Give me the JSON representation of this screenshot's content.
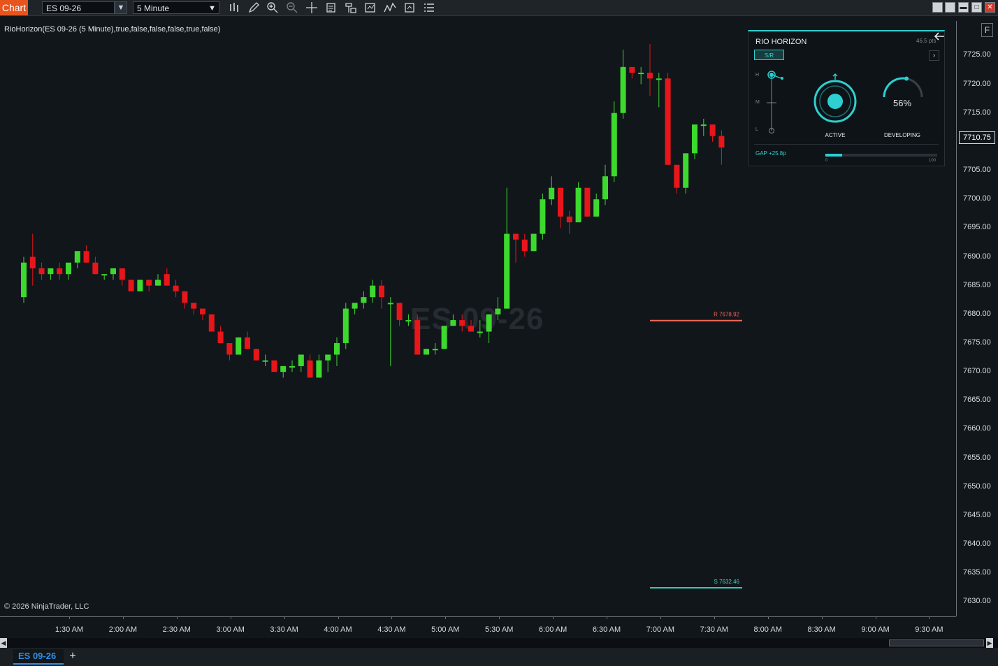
{
  "toolbar": {
    "chart_tab": "Chart",
    "instrument": "ES 09-26",
    "interval": "5 Minute",
    "icons": [
      "bars-type-icon",
      "pencil-icon",
      "zoom-in-icon",
      "zoom-out-icon",
      "crosshair-icon",
      "data-box-icon",
      "properties-icon",
      "strategies-icon",
      "indicators-icon",
      "templates-icon",
      "list-icon"
    ]
  },
  "window_buttons": [
    "tile-icon",
    "tile-icon",
    "minimize-icon",
    "maximize-icon",
    "close-icon"
  ],
  "chart": {
    "indicator_label": "RioHorizon(ES 09-26 (5 Minute),true,false,false,false,true,false)",
    "watermark": "ES 09-26",
    "copyright": "© 2026 NinjaTrader, LLC",
    "f_button": "F",
    "last_price": "7710.75",
    "up_color": "#3dd92e",
    "down_color": "#e8161a",
    "resistance_label": "R 7678.92",
    "resistance_value": 7678.92,
    "support_label": "S 7632.46",
    "support_value": 7632.46
  },
  "chart_data": {
    "type": "candlestick",
    "price_ticks": [
      "7725.00",
      "7720.00",
      "7715.00",
      "7710.00",
      "7705.00",
      "7700.00",
      "7695.00",
      "7690.00",
      "7685.00",
      "7680.00",
      "7675.00",
      "7670.00",
      "7665.00",
      "7660.00",
      "7655.00",
      "7650.00",
      "7645.00",
      "7640.00",
      "7635.00",
      "7630.00"
    ],
    "time_ticks": [
      "1:30 AM",
      "2:00 AM",
      "2:30 AM",
      "3:00 AM",
      "3:30 AM",
      "4:00 AM",
      "4:30 AM",
      "5:00 AM",
      "5:30 AM",
      "6:00 AM",
      "6:30 AM",
      "7:00 AM",
      "7:30 AM",
      "8:00 AM",
      "8:30 AM",
      "9:00 AM",
      "9:30 AM"
    ],
    "ylim": [
      7627.5,
      7731.0
    ],
    "candles": [
      [
        7683,
        7690,
        7682,
        7689
      ],
      [
        7690,
        7694,
        7685,
        7688
      ],
      [
        7688,
        7689,
        7686,
        7687
      ],
      [
        7687,
        7688,
        7686,
        7688
      ],
      [
        7688,
        7689,
        7686,
        7687
      ],
      [
        7687,
        7688,
        7686,
        7689
      ],
      [
        7689,
        7691,
        7688,
        7691
      ],
      [
        7691,
        7692,
        7689,
        7689
      ],
      [
        7689,
        7690,
        7687,
        7687
      ],
      [
        7687,
        7687,
        7686,
        7687
      ],
      [
        7687,
        7688,
        7686,
        7688
      ],
      [
        7688,
        7688,
        7685,
        7686
      ],
      [
        7686,
        7686,
        7684,
        7684
      ],
      [
        7684,
        7686,
        7684,
        7686
      ],
      [
        7686,
        7686,
        7684,
        7685
      ],
      [
        7685,
        7687,
        7685,
        7686
      ],
      [
        7687,
        7688,
        7685,
        7685
      ],
      [
        7685,
        7686,
        7683,
        7684
      ],
      [
        7684,
        7684,
        7681,
        7682
      ],
      [
        7682,
        7682,
        7680,
        7681
      ],
      [
        7681,
        7681,
        7679,
        7680
      ],
      [
        7680,
        7680,
        7677,
        7677
      ],
      [
        7677,
        7678,
        7675,
        7675
      ],
      [
        7675,
        7675,
        7672,
        7673
      ],
      [
        7673,
        7676,
        7673,
        7676
      ],
      [
        7676,
        7677,
        7674,
        7674
      ],
      [
        7674,
        7674,
        7672,
        7672
      ],
      [
        7672,
        7673,
        7671,
        7672
      ],
      [
        7672,
        7672,
        7670,
        7670
      ],
      [
        7670,
        7671,
        7669,
        7671
      ],
      [
        7671,
        7672,
        7670,
        7671
      ],
      [
        7671,
        7673,
        7670,
        7673
      ],
      [
        7672,
        7673,
        7669,
        7669
      ],
      [
        7669,
        7673,
        7669,
        7672
      ],
      [
        7672,
        7673,
        7670,
        7673
      ],
      [
        7673,
        7676,
        7671,
        7675
      ],
      [
        7675,
        7682,
        7674,
        7681
      ],
      [
        7681,
        7682,
        7680,
        7682
      ],
      [
        7682,
        7684,
        7681,
        7683
      ],
      [
        7683,
        7686,
        7682,
        7685
      ],
      [
        7685,
        7686,
        7681,
        7683
      ],
      [
        7682,
        7683,
        7671,
        7682
      ],
      [
        7682,
        7682,
        7678,
        7679
      ],
      [
        7679,
        7680,
        7678,
        7679
      ],
      [
        7679,
        7680,
        7673,
        7673
      ],
      [
        7673,
        7674,
        7673,
        7674
      ],
      [
        7674,
        7675,
        7673,
        7674
      ],
      [
        7674,
        7678,
        7674,
        7678
      ],
      [
        7678,
        7680,
        7678,
        7679
      ],
      [
        7679,
        7680,
        7677,
        7678
      ],
      [
        7678,
        7679,
        7677,
        7677
      ],
      [
        7677,
        7679,
        7676,
        7677
      ],
      [
        7677,
        7680,
        7675,
        7680
      ],
      [
        7680,
        7683,
        7679,
        7681
      ],
      [
        7681,
        7702,
        7681,
        7694
      ],
      [
        7694,
        7694,
        7689,
        7693
      ],
      [
        7693,
        7694,
        7690,
        7691
      ],
      [
        7691,
        7694,
        7691,
        7694
      ],
      [
        7694,
        7701,
        7693,
        7700
      ],
      [
        7700,
        7704,
        7699,
        7702
      ],
      [
        7702,
        7702,
        7695,
        7697
      ],
      [
        7697,
        7698,
        7694,
        7696
      ],
      [
        7696,
        7703,
        7696,
        7702
      ],
      [
        7702,
        7702,
        7697,
        7697
      ],
      [
        7697,
        7701,
        7697,
        7700
      ],
      [
        7700,
        7706,
        7699,
        7704
      ],
      [
        7704,
        7717,
        7703,
        7715
      ],
      [
        7715,
        7726,
        7714,
        7723
      ],
      [
        7723,
        7723,
        7721,
        7722
      ],
      [
        7722,
        7723,
        7720,
        7722
      ],
      [
        7722,
        7727,
        7718,
        7721
      ],
      [
        7721,
        7722,
        7716,
        7721
      ],
      [
        7721,
        7722,
        7706,
        7706
      ],
      [
        7706,
        7706,
        7701,
        7702
      ],
      [
        7702,
        7705,
        7701,
        7708
      ],
      [
        7708,
        7712,
        7707,
        7713
      ],
      [
        7713,
        7714,
        7711,
        7713
      ],
      [
        7713,
        7713,
        7710,
        7711
      ],
      [
        7711,
        7712,
        7706,
        7709
      ]
    ]
  },
  "widget": {
    "title": "RIO HORIZON",
    "points": "46.5 pts",
    "tab": "S/R",
    "slider_labels": [
      "H",
      "M",
      "L"
    ],
    "active_label": "ACTIVE",
    "percent": "56%",
    "percent_value": 56,
    "developing_label": "DEVELOPING",
    "gap_label": "GAP +25.8p",
    "progress_min": "0",
    "progress_max": "100",
    "progress_value": 15,
    "accent": "#2ecfd0"
  },
  "bottom": {
    "tab": "ES 09-26",
    "add": "+"
  }
}
